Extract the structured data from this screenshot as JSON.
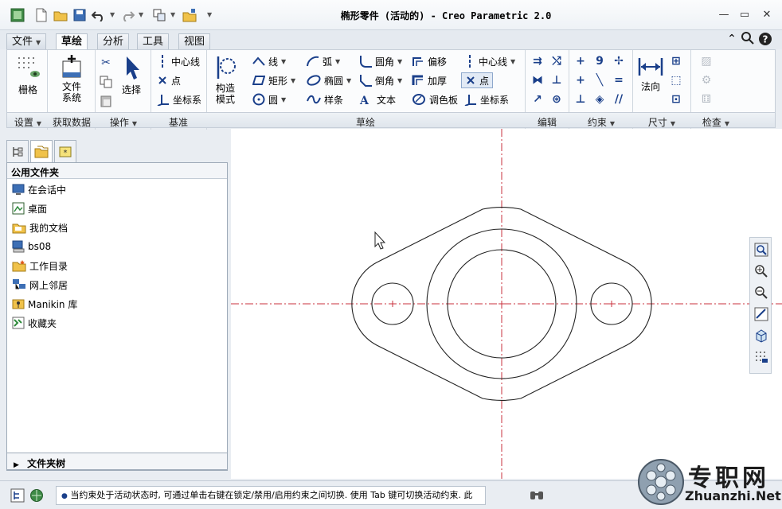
{
  "window": {
    "title": "椭形零件 (活动的) - Creo Parametric 2.0"
  },
  "tabs": [
    {
      "label": "文件",
      "has_dropdown": true
    },
    {
      "label": "草绘",
      "active": true
    },
    {
      "label": "分析"
    },
    {
      "label": "工具"
    },
    {
      "label": "视图"
    }
  ],
  "ribbon": {
    "grid": {
      "label": "栅格",
      "group": "设置"
    },
    "file_system": {
      "label_line1": "文件",
      "label_line2": "系统",
      "group": "获取数据"
    },
    "select": {
      "label": "选择",
      "group": "操作"
    },
    "datum": {
      "centerline": "中心线",
      "point": "点",
      "coord_sys": "坐标系",
      "group": "基准"
    },
    "construction": {
      "label_line1": "构造",
      "label_line2": "模式"
    },
    "sketch": {
      "line": "线",
      "rectangle": "矩形",
      "circle": "圆",
      "arc": "弧",
      "ellipse": "椭圆",
      "spline": "样条",
      "fillet": "圆角",
      "chamfer": "倒角",
      "text": "文本",
      "offset": "偏移",
      "thicken": "加厚",
      "palette": "调色板",
      "centerline": "中心线",
      "point": "点",
      "coord_sys": "坐标系",
      "group": "草绘"
    },
    "edit": {
      "group": "编辑"
    },
    "constrain": {
      "group": "约束"
    },
    "dimension": {
      "normal": "法向",
      "group": "尺寸"
    },
    "inspect": {
      "group": "检查"
    }
  },
  "groups": [
    "设置",
    "获取数据",
    "操作",
    "基准",
    "草绘",
    "编辑",
    "约束",
    "尺寸",
    "检查"
  ],
  "panel": {
    "title": "公用文件夹",
    "items": [
      "在会话中",
      "桌面",
      "我的文档",
      "bs08",
      "工作目录",
      "网上邻居",
      "Manikin 库",
      "收藏夹"
    ],
    "tree_label": "文件夹树"
  },
  "status": {
    "message": "当约束处于活动状态时, 可通过单击右键在锁定/禁用/启用约束之间切换. 使用 Tab 键可切换活动约束. 此"
  },
  "watermark": {
    "cn": "专职网",
    "url": "Zhuanzhi.Net"
  },
  "colors": {
    "accent": "#1a3f8a",
    "centerline": "#c8323c",
    "geometry": "#222222"
  }
}
